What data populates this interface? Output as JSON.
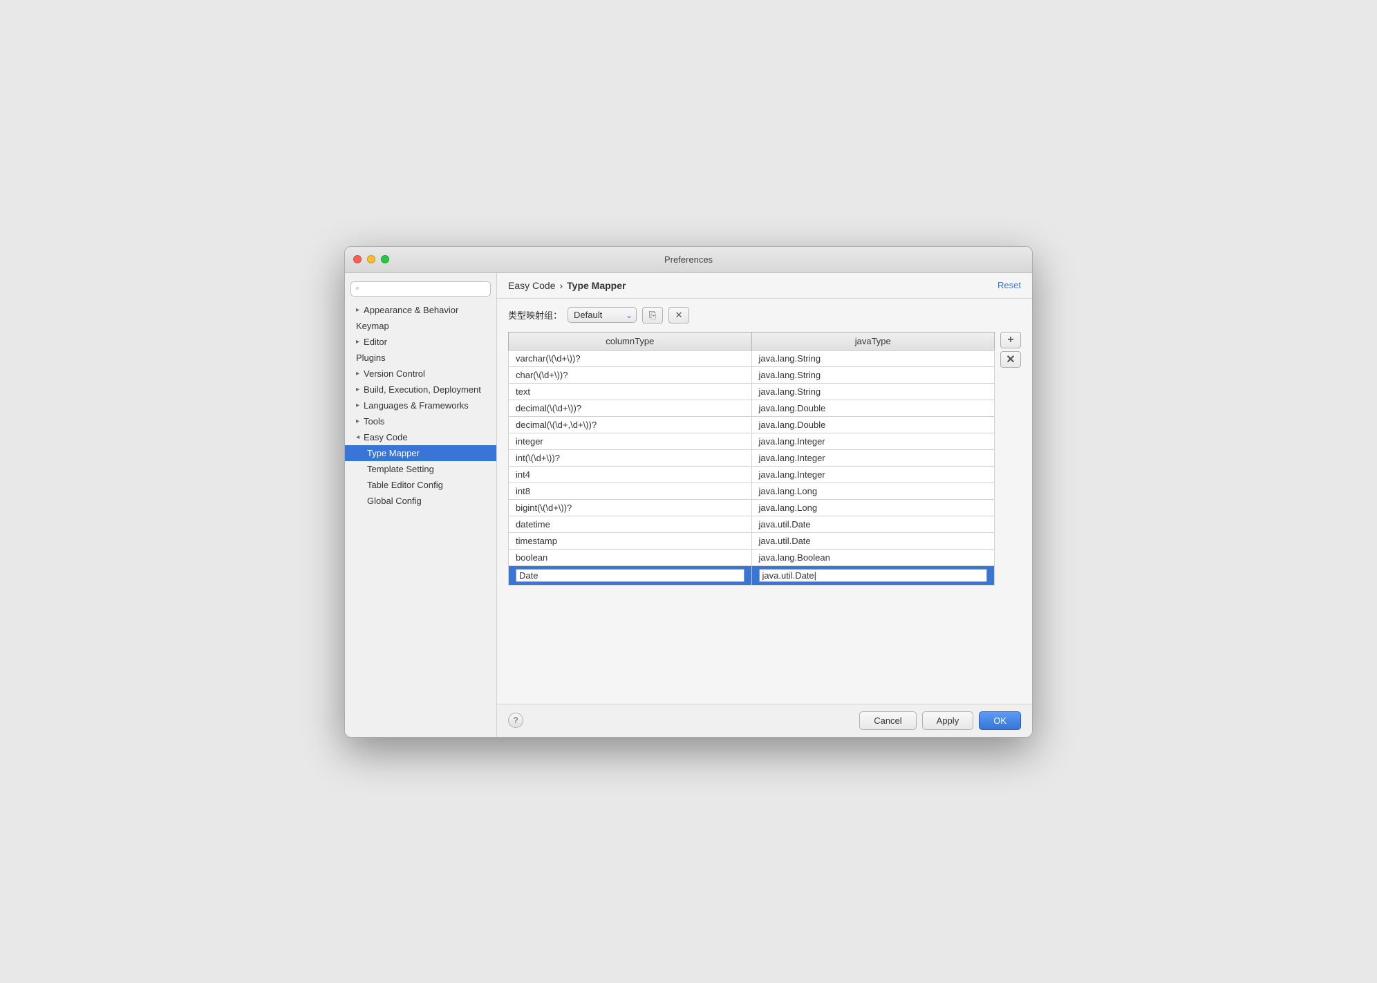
{
  "window": {
    "title": "Preferences"
  },
  "sidebar": {
    "search_placeholder": "🔍",
    "items": [
      {
        "id": "appearance",
        "label": "Appearance & Behavior",
        "expandable": true,
        "expanded": false,
        "indent": 0
      },
      {
        "id": "keymap",
        "label": "Keymap",
        "expandable": false,
        "indent": 0
      },
      {
        "id": "editor",
        "label": "Editor",
        "expandable": true,
        "expanded": false,
        "indent": 0
      },
      {
        "id": "plugins",
        "label": "Plugins",
        "expandable": false,
        "indent": 0
      },
      {
        "id": "version-control",
        "label": "Version Control",
        "expandable": true,
        "expanded": false,
        "indent": 0
      },
      {
        "id": "build",
        "label": "Build, Execution, Deployment",
        "expandable": true,
        "expanded": false,
        "indent": 0
      },
      {
        "id": "languages",
        "label": "Languages & Frameworks",
        "expandable": true,
        "expanded": false,
        "indent": 0
      },
      {
        "id": "tools",
        "label": "Tools",
        "expandable": true,
        "expanded": false,
        "indent": 0
      },
      {
        "id": "easycode",
        "label": "Easy Code",
        "expandable": true,
        "expanded": true,
        "indent": 0
      },
      {
        "id": "type-mapper",
        "label": "Type Mapper",
        "expandable": false,
        "indent": 1,
        "selected": true
      },
      {
        "id": "template-setting",
        "label": "Template Setting",
        "expandable": false,
        "indent": 1
      },
      {
        "id": "table-editor",
        "label": "Table Editor Config",
        "expandable": false,
        "indent": 1
      },
      {
        "id": "global-config",
        "label": "Global Config",
        "expandable": false,
        "indent": 1
      }
    ]
  },
  "panel": {
    "breadcrumb_parent": "Easy Code",
    "breadcrumb_separator": "›",
    "breadcrumb_current": "Type Mapper",
    "reset_label": "Reset",
    "toolbar_label": "类型映射组：",
    "select_value": "Default",
    "select_options": [
      "Default"
    ],
    "table": {
      "col1": "columnType",
      "col2": "javaType",
      "rows": [
        {
          "col1": "varchar(\\(\\d+\\))?",
          "col2": "java.lang.String",
          "selected": false
        },
        {
          "col1": "char(\\(\\d+\\))?",
          "col2": "java.lang.String",
          "selected": false
        },
        {
          "col1": "text",
          "col2": "java.lang.String",
          "selected": false
        },
        {
          "col1": "decimal(\\(\\d+\\))?",
          "col2": "java.lang.Double",
          "selected": false
        },
        {
          "col1": "decimal(\\(\\d+,\\d+\\))?",
          "col2": "java.lang.Double",
          "selected": false
        },
        {
          "col1": "integer",
          "col2": "java.lang.Integer",
          "selected": false
        },
        {
          "col1": "int(\\(\\d+\\))?",
          "col2": "java.lang.Integer",
          "selected": false
        },
        {
          "col1": "int4",
          "col2": "java.lang.Integer",
          "selected": false
        },
        {
          "col1": "int8",
          "col2": "java.lang.Long",
          "selected": false
        },
        {
          "col1": "bigint(\\(\\d+\\))?",
          "col2": "java.lang.Long",
          "selected": false
        },
        {
          "col1": "datetime",
          "col2": "java.util.Date",
          "selected": false
        },
        {
          "col1": "timestamp",
          "col2": "java.util.Date",
          "selected": false
        },
        {
          "col1": "boolean",
          "col2": "java.lang.Boolean",
          "selected": false
        },
        {
          "col1": "Date",
          "col2": "java.util.Date|",
          "selected": true
        }
      ]
    }
  },
  "buttons": {
    "cancel": "Cancel",
    "apply": "Apply",
    "ok": "OK",
    "help": "?"
  }
}
